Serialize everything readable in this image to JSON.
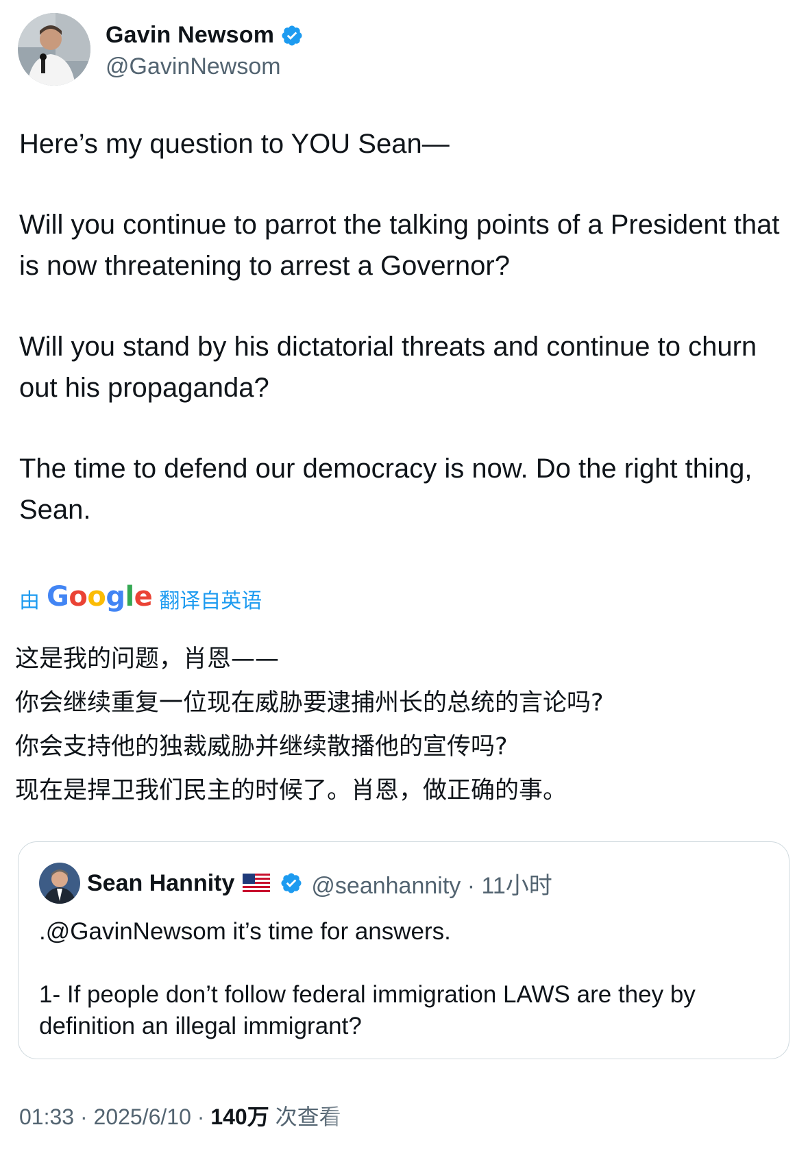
{
  "author": {
    "display_name": "Gavin Newsom",
    "handle": "@GavinNewsom"
  },
  "tweet": {
    "paragraphs": [
      "Here’s my question to YOU Sean—",
      "Will you continue to parrot the talking points of a President that is now threatening to arrest a Governor?",
      "Will you stand by his dictatorial threats and continue to churn out his propaganda?",
      "The time to defend our democracy is now. Do the right thing, Sean."
    ]
  },
  "translation": {
    "by_label": "由",
    "provider": "Google",
    "from_label": "翻译自英语",
    "lines": [
      "这是我的问题，肖恩——",
      "你会继续重复一位现在威胁要逮捕州长的总统的言论吗?",
      "你会支持他的独裁威胁并继续散播他的宣传吗?",
      "现在是捍卫我们民主的时候了。肖恩，做正确的事。"
    ]
  },
  "quoted_tweet": {
    "display_name": "Sean Hannity",
    "handle_time": "@seanhannity · 11小时",
    "paragraphs": [
      ".@GavinNewsom  it’s time for answers.",
      "1- If people don’t follow federal immigration LAWS are they by definition an illegal immigrant?"
    ]
  },
  "footer": {
    "time_date": "01:33 · 2025/6/10 · ",
    "views": "140万",
    "views_label": " 次查看"
  },
  "colors": {
    "text": "#0f1419",
    "secondary": "#536471",
    "link_blue": "#1d9bf0",
    "border": "#cfd9de"
  }
}
